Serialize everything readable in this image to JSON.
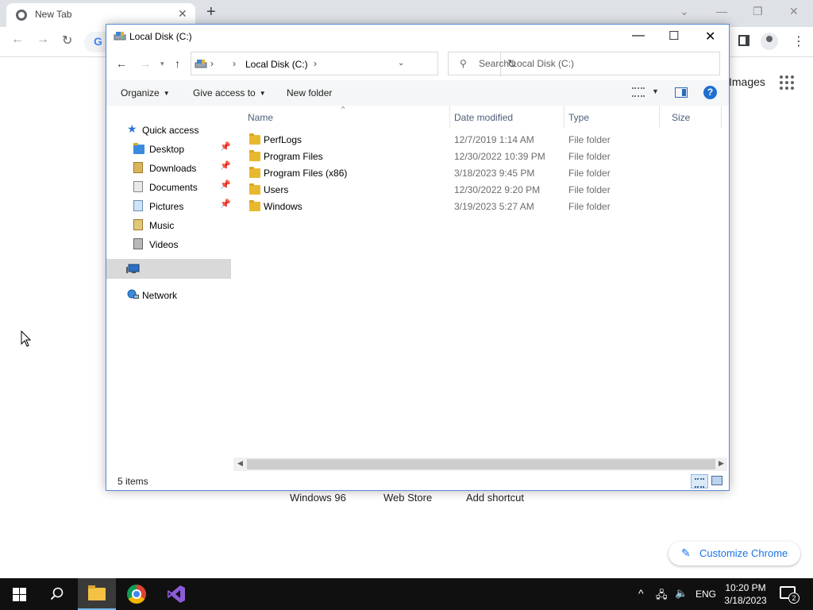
{
  "chrome": {
    "tab_title": "New Tab",
    "tab_close": "✕",
    "new_tab": "+",
    "omnibox_letter": "G",
    "images_link": "Images",
    "shortcuts": [
      "Windows 96",
      "Web Store",
      "Add shortcut"
    ],
    "customize_label": "Customize Chrome"
  },
  "explorer": {
    "window_title": "Local Disk (C:)",
    "breadcrumb": "Local Disk (C:)",
    "breadcrumb_sep": "›",
    "search_placeholder": "Search Local Disk (C:)",
    "commands": {
      "organize": "Organize",
      "give_access": "Give access to",
      "new_folder": "New folder"
    },
    "help_glyph": "?",
    "nav": {
      "quick_access": "Quick access",
      "items": [
        {
          "label": "Desktop",
          "pinned": true,
          "icon": "folder-icon"
        },
        {
          "label": "Downloads",
          "pinned": true,
          "icon": "downloads-icon"
        },
        {
          "label": "Documents",
          "pinned": true,
          "icon": "documents-icon"
        },
        {
          "label": "Pictures",
          "pinned": true,
          "icon": "pictures-icon"
        },
        {
          "label": "Music",
          "pinned": false,
          "icon": "music-icon"
        },
        {
          "label": "Videos",
          "pinned": false,
          "icon": "videos-icon"
        }
      ],
      "this_pc": "",
      "network": "Network"
    },
    "columns": [
      "Name",
      "Date modified",
      "Type",
      "Size"
    ],
    "files": [
      {
        "name": "PerfLogs",
        "date": "12/7/2019 1:14 AM",
        "type": "File folder",
        "size": ""
      },
      {
        "name": "Program Files",
        "date": "12/30/2022 10:39 PM",
        "type": "File folder",
        "size": ""
      },
      {
        "name": "Program Files (x86)",
        "date": "3/18/2023 9:45 PM",
        "type": "File folder",
        "size": ""
      },
      {
        "name": "Users",
        "date": "12/30/2022 9:20 PM",
        "type": "File folder",
        "size": ""
      },
      {
        "name": "Windows",
        "date": "3/19/2023 5:27 AM",
        "type": "File folder",
        "size": ""
      }
    ],
    "status": "5 items"
  },
  "taskbar": {
    "lang": "ENG",
    "time": "10:20 PM",
    "date": "3/18/2023",
    "notifications": "2"
  },
  "colors": {
    "accent": "#1a73e8",
    "folder": "#e8b82e",
    "taskbar": "#101010"
  }
}
